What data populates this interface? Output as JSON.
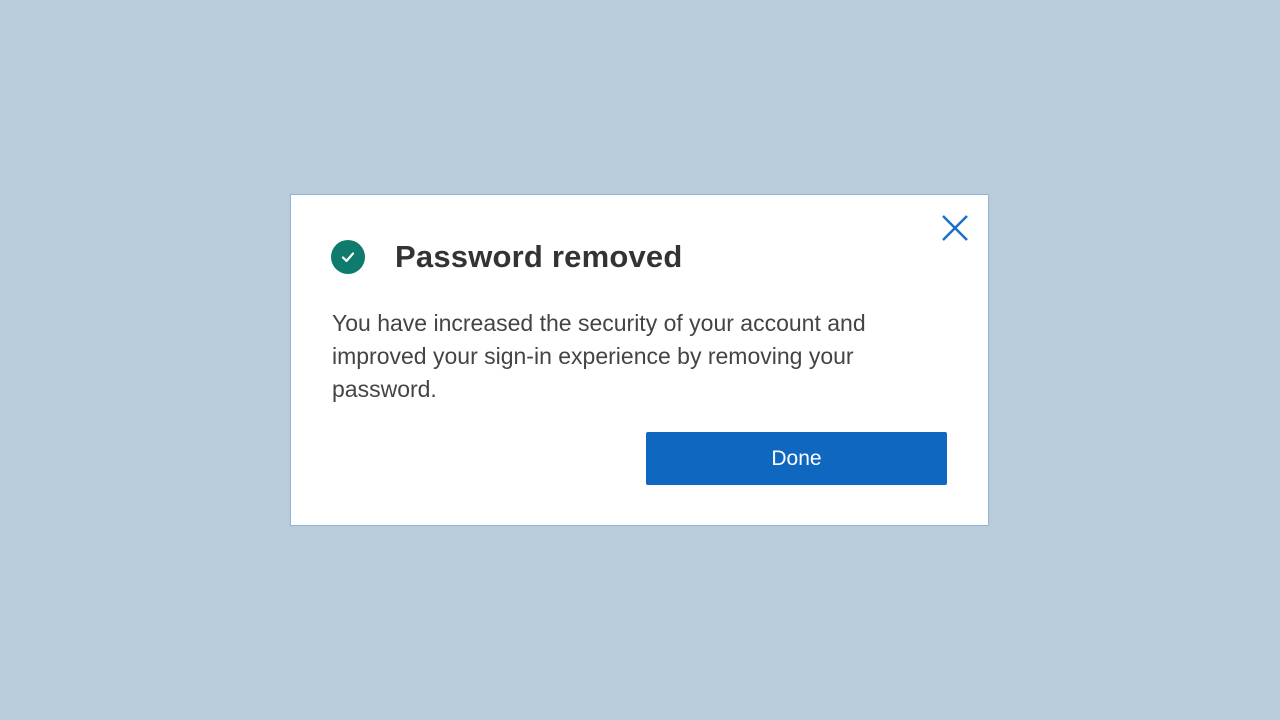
{
  "dialog": {
    "title": "Password removed",
    "message": "You have increased the security of your account and improved your sign-in experience by removing your password.",
    "done_label": "Done",
    "icons": {
      "status": "check-circle-icon",
      "close": "close-icon"
    },
    "colors": {
      "background": "#b9ccdb",
      "success": "#0f7b6c",
      "primary_button": "#0f67bf",
      "close_icon": "#1a6fc4"
    }
  }
}
